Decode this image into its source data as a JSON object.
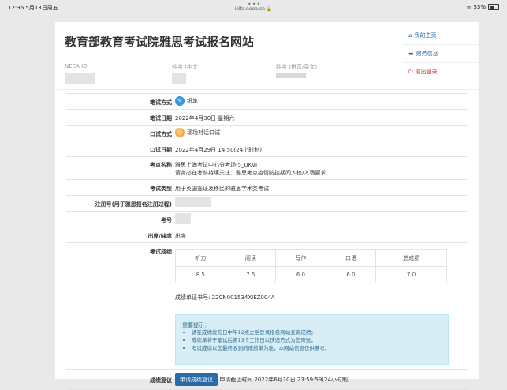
{
  "status_bar": {
    "time": "12:36  5月13日周五",
    "url": "ielts.neea.cn",
    "battery": "53%"
  },
  "header": {
    "title": "教育部教育考试院雅思考试报名网站",
    "neea_id_label": "NEEA ID",
    "name_cn_label": "姓名 (中文)",
    "name_en_label": "姓名 (拼音/英文)"
  },
  "side_links": {
    "home": "我的主页",
    "finance": "财务信息",
    "logout": "退出登录"
  },
  "rows": {
    "written_mode": {
      "label": "笔试方式",
      "value": "纸笔"
    },
    "written_date": {
      "label": "笔试日期",
      "value": "2022年4月30日 星期六"
    },
    "speaking_mode": {
      "label": "口试方式",
      "value": "现场对话口试"
    },
    "speaking_date": {
      "label": "口试日期",
      "value": "2022年4月29日 14:50(24小时制)"
    },
    "venue": {
      "label": "考点名称",
      "value": "雅思上海考试中心分考场-5_UKVI",
      "note": "请务必在考前持续关注：雅思考点疫情防控期间入校/入场要求"
    },
    "test_type": {
      "label": "考试类型",
      "value": "用于英国签证及移民的雅思学术类考试"
    },
    "reg_no": {
      "label": "注册号(用于雅思报名注册过程)"
    },
    "candidate_no": {
      "label": "考号"
    },
    "attendance": {
      "label": "出席/缺席",
      "value": "出席"
    },
    "results": {
      "label": "考试成绩"
    },
    "review": {
      "label": "成绩复议",
      "button": "申请成绩复议",
      "deadline": "申请截止时间 2022年6月10日 23:59:59(24小时制)"
    }
  },
  "scores": {
    "headers": [
      "听力",
      "阅读",
      "写作",
      "口语",
      "总成绩"
    ],
    "values": [
      "8.5",
      "7.5",
      "6.0",
      "6.0",
      "7.0"
    ]
  },
  "certificate": "成绩单证书号: 22CN001534XIEZ004A",
  "tips": {
    "title": "重要提示：",
    "items": [
      "请在成绩发布日中午12点之后登录报名网站查询成绩；",
      "成绩单将于笔试后第13个工作日以快递方式为您寄送；",
      "考试成绩以您最终收到的成绩单为准，本网站信息仅供参考。"
    ]
  }
}
